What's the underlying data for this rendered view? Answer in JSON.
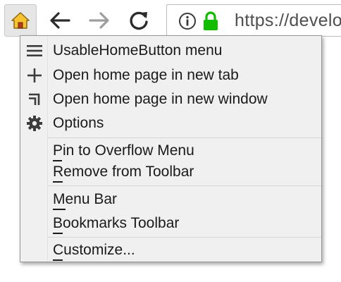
{
  "toolbar": {
    "home_icon": "home-icon",
    "back_icon": "back-arrow-icon",
    "forward_icon": "forward-arrow-icon",
    "reload_icon": "reload-icon",
    "url_text": "https://develo",
    "info_icon": "info-icon",
    "lock_icon": "lock-icon",
    "lock_color": "#12bc00"
  },
  "menu": {
    "items": [
      {
        "icon": "hamburger-icon",
        "label": "UsableHomeButton menu"
      },
      {
        "icon": "plus-icon",
        "label": "Open home page in new tab"
      },
      {
        "icon": "new-window-icon",
        "label": "Open home page in new window"
      },
      {
        "icon": "gear-icon",
        "label": "Options"
      },
      {
        "label": "Pin to Overflow Menu",
        "access_key": "P"
      },
      {
        "label": "Remove from Toolbar",
        "access_key": "R"
      },
      {
        "label": "Menu Bar",
        "access_key": "M"
      },
      {
        "label": "Bookmarks Toolbar",
        "access_key": "B"
      },
      {
        "label": "Customize...",
        "access_key": "C"
      }
    ]
  }
}
